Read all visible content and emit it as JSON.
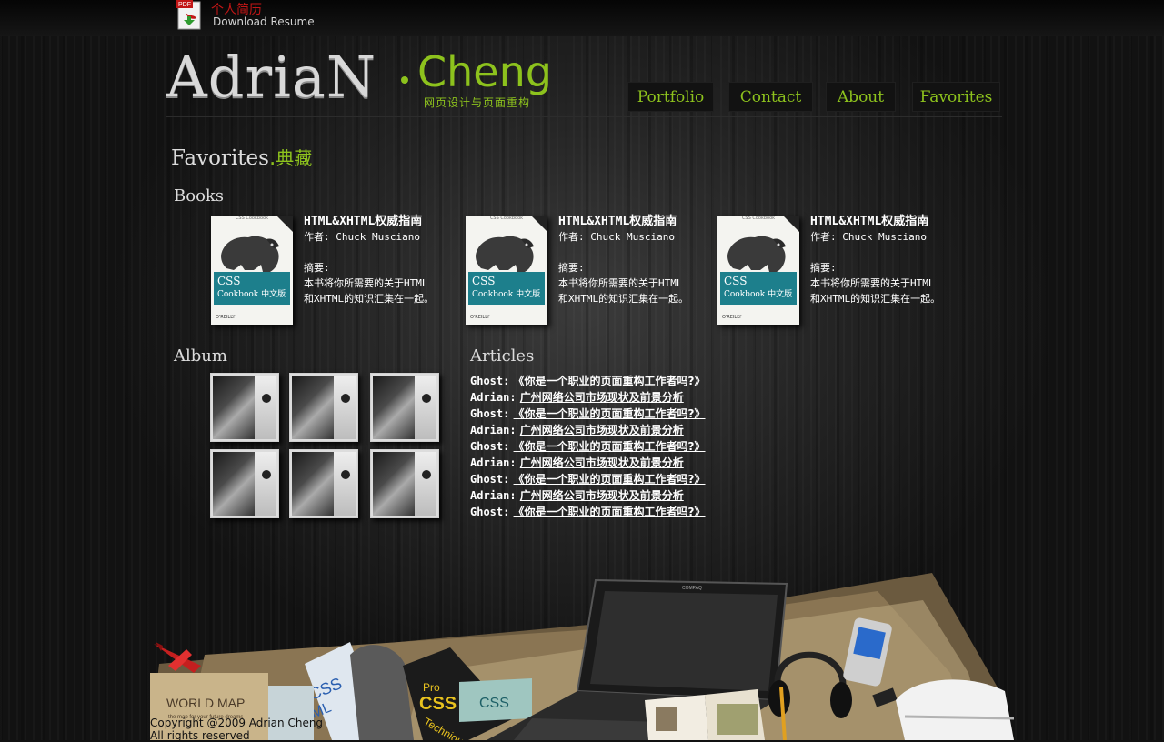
{
  "resume": {
    "cn_label": "个人简历",
    "en_label": "Download Resume",
    "icon_text": "PDF"
  },
  "logo": {
    "name": "AdriaN",
    "surname": "Cheng",
    "tagline": "网页设计与页面重构"
  },
  "nav": [
    {
      "label": "Portfolio"
    },
    {
      "label": "Contact"
    },
    {
      "label": "About"
    },
    {
      "label": "Favorites"
    }
  ],
  "page": {
    "title_en": "Favorites",
    "title_dot": ".",
    "title_cn": "典藏"
  },
  "sections": {
    "books": "Books",
    "album": "Album",
    "articles": "Articles"
  },
  "books": [
    {
      "title": "HTML&XHTML权威指南",
      "author": "作者: Chuck Musciano",
      "summary_label": "摘要:",
      "summary_1": "本书将你所需要的关于HTML",
      "summary_2": "和XHTML的知识汇集在一起。",
      "cover_title_1": "CSS",
      "cover_title_2": "Cookbook 中文版",
      "cover_top": "CSS Cookbook",
      "publisher": "O'REILLY"
    },
    {
      "title": "HTML&XHTML权威指南",
      "author": "作者: Chuck Musciano",
      "summary_label": "摘要:",
      "summary_1": "本书将你所需要的关于HTML",
      "summary_2": "和XHTML的知识汇集在一起。",
      "cover_title_1": "CSS",
      "cover_title_2": "Cookbook 中文版",
      "cover_top": "CSS Cookbook",
      "publisher": "O'REILLY"
    },
    {
      "title": "HTML&XHTML权威指南",
      "author": "作者: Chuck Musciano",
      "summary_label": "摘要:",
      "summary_1": "本书将你所需要的关于HTML",
      "summary_2": "和XHTML的知识汇集在一起。",
      "cover_title_1": "CSS",
      "cover_title_2": "Cookbook 中文版",
      "cover_top": "CSS Cookbook",
      "publisher": "O'REILLY"
    }
  ],
  "album_count": 6,
  "articles": [
    {
      "author": "Ghost:",
      "title": "《你是一个职业的页面重构工作者吗?》"
    },
    {
      "author": "Adrian:",
      "title": "广州网络公司市场现状及前景分析"
    },
    {
      "author": "Ghost:",
      "title": "《你是一个职业的页面重构工作者吗?》"
    },
    {
      "author": "Adrian:",
      "title": "广州网络公司市场现状及前景分析"
    },
    {
      "author": "Ghost:",
      "title": "《你是一个职业的页面重构工作者吗?》"
    },
    {
      "author": "Adrian:",
      "title": "广州网络公司市场现状及前景分析"
    },
    {
      "author": "Ghost:",
      "title": "《你是一个职业的页面重构工作者吗?》"
    },
    {
      "author": "Adrian:",
      "title": "广州网络公司市场现状及前景分析"
    },
    {
      "author": "Ghost:",
      "title": "《你是一个职业的页面重构工作者吗?》"
    }
  ],
  "footer": {
    "line1": "Copyright @2009 Adrian Cheng",
    "line2": "All rights reserved",
    "map_label": "WORLD MAP",
    "map_tagline": "the map for your future dreams",
    "book_pro": "Pro",
    "book_css": "CSS",
    "book_tech": "Technique",
    "book_css2": "CSS",
    "book_xhtml": "XHTML",
    "laptop_brand": "COMPAQ"
  },
  "colors": {
    "accent": "#8dc21d",
    "resume_red": "#c21616",
    "teal": "#1d7f8c"
  }
}
